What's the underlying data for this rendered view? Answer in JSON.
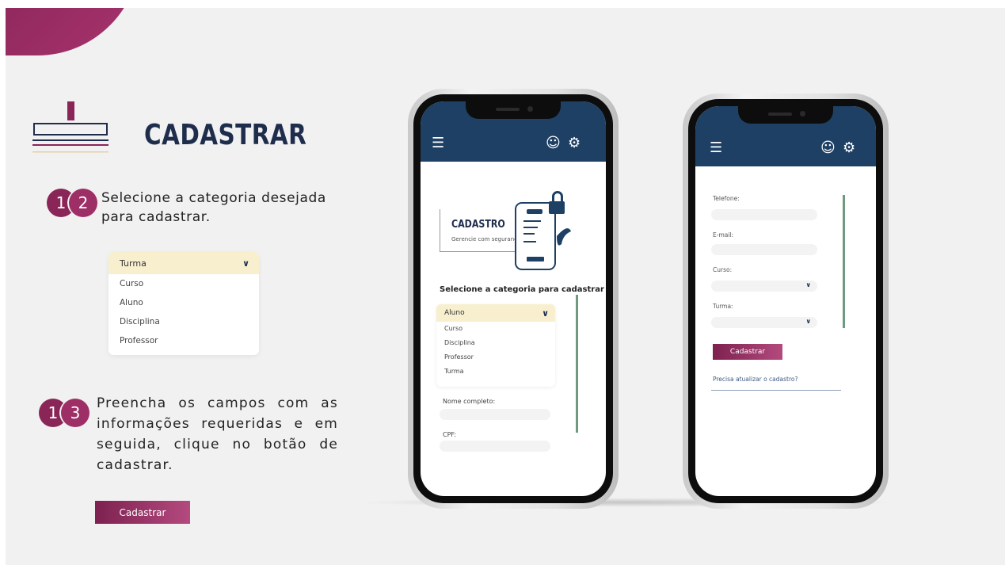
{
  "slide": {
    "title": "CADASTRAR",
    "steps": [
      {
        "d1": "1",
        "d2": "2",
        "text": "Selecione a categoria desejada para cadastrar."
      },
      {
        "d1": "1",
        "d2": "3",
        "text": "Preencha os campos com as informações requeridas e em seguida, clique no botão de cadastrar."
      }
    ],
    "dropdown": {
      "selected": "Turma",
      "options": [
        "Curso",
        "Aluno",
        "Disciplina",
        "Professor"
      ]
    },
    "button_label": "Cadastrar"
  },
  "phone1": {
    "card_title": "CADASTRO",
    "card_subtitle": "Gerencie com segurança",
    "select_label": "Selecione a categoria para cadastrar",
    "dropdown": {
      "selected": "Aluno",
      "options": [
        "Curso",
        "Disciplina",
        "Professor",
        "Turma"
      ]
    },
    "fields": [
      {
        "label": "Nome completo:"
      },
      {
        "label": "CPF:"
      }
    ]
  },
  "phone2": {
    "fields": [
      {
        "label": "Telefone:"
      },
      {
        "label": "E-mail:"
      },
      {
        "label": "Curso:"
      },
      {
        "label": "Turma:"
      }
    ],
    "button_label": "Cadastrar",
    "link_text": "Precisa atualizar o cadastro?"
  },
  "icons": [
    "menu-icon",
    "user-icon",
    "settings-icon",
    "chevron-down-icon",
    "lock-icon"
  ],
  "colors": {
    "brand_magenta": "#8a2657",
    "navy": "#1e4065",
    "accent_green": "#6e9a7f",
    "highlight": "#f8efcf"
  }
}
